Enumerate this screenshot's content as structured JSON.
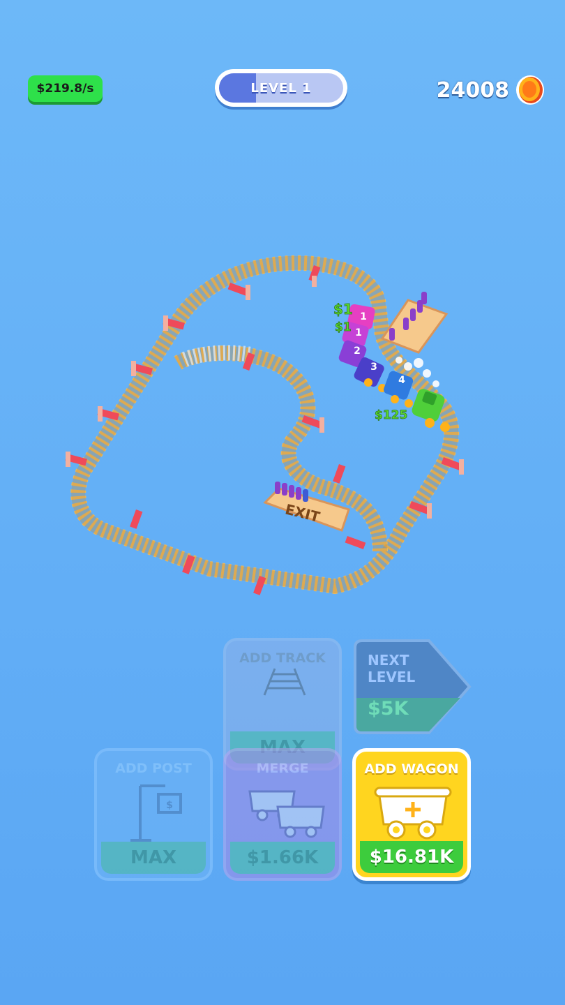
{
  "hud": {
    "income_rate": "$219.8/s",
    "level_label": "LEVEL 1",
    "level_progress": 0.3,
    "coins": "24008"
  },
  "board": {
    "exit_label": "EXIT",
    "floating_rewards": [
      "$1",
      "$1",
      "$125"
    ],
    "wagon_numbers": [
      "1",
      "1",
      "2",
      "3",
      "4"
    ]
  },
  "buttons": {
    "add_track": {
      "title": "ADD TRACK",
      "price": "MAX"
    },
    "next_level": {
      "title_line1": "NEXT",
      "title_line2": "LEVEL",
      "price": "$5K"
    },
    "add_post": {
      "title": "ADD POST",
      "price": "MAX"
    },
    "merge": {
      "title": "MERGE",
      "price": "$1.66K"
    },
    "add_wagon": {
      "title": "ADD WAGON",
      "price": "$16.81K"
    }
  },
  "colors": {
    "background": "#64b0f6",
    "track_ties": "#e8b860",
    "rail": "#c8903a",
    "post": "#ef4a5a",
    "income_badge": "#2ee04a",
    "add_wagon_yellow": "#ffd51f",
    "add_wagon_price": "#3dcc3d"
  },
  "icons": [
    "coin-icon",
    "track-icon",
    "post-icon",
    "merge-icon",
    "wagon-plus-icon"
  ]
}
